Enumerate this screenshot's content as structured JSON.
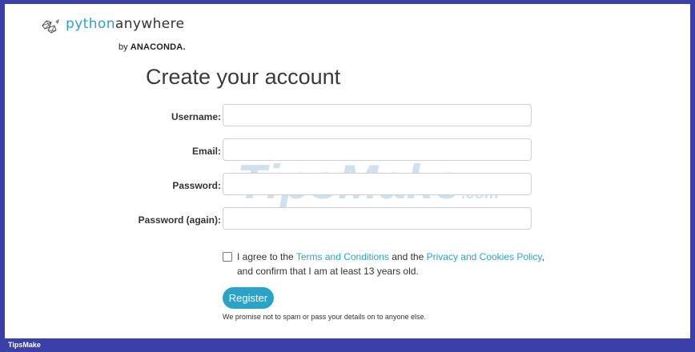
{
  "logo": {
    "part1": "python",
    "part2": "anywhere",
    "by": "by",
    "brand": "ANACONDA."
  },
  "form": {
    "heading": "Create your account",
    "fields": [
      {
        "label": "Username:",
        "value": "",
        "placeholder": ""
      },
      {
        "label": "Email:",
        "value": "",
        "placeholder": ""
      },
      {
        "label": "Password:",
        "value": "",
        "placeholder": ""
      },
      {
        "label": "Password (again):",
        "value": "",
        "placeholder": ""
      }
    ],
    "agree": {
      "checked": false,
      "prefix": "I agree to the ",
      "terms_link": "Terms and Conditions",
      "middle": " and the ",
      "privacy_link": "Privacy and Cookies Policy",
      "suffix": ",",
      "line2": "and confirm that I am at least 13 years old."
    },
    "register_label": "Register",
    "promise": "We promise not to spam or pass your details on to anyone else."
  },
  "watermark": {
    "main": "TipsMake",
    "suffix": ".com"
  },
  "footer": {
    "label": "TipsMake"
  },
  "colors": {
    "accent": "#2ba3c8",
    "frame": "#3b3fa8"
  }
}
